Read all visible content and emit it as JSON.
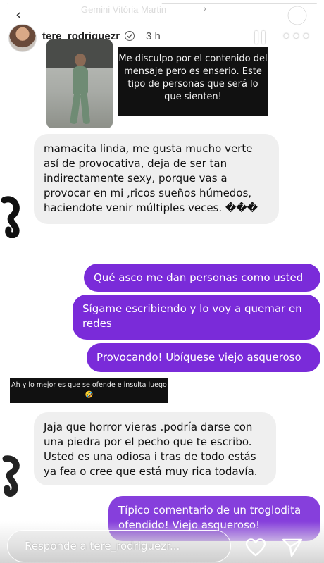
{
  "story": {
    "progress": 0.5,
    "ghost_title": "Gemini Vitória Martin",
    "username": "tere_rodriguezr",
    "time": "3 h",
    "icons": {
      "back": "chevron-left-icon",
      "verified": "verified-badge-icon",
      "pause": "pause-icon",
      "more": "more-icon",
      "sticker": "sticker-icon",
      "heart": "heart-icon",
      "share": "paper-plane-icon"
    }
  },
  "captions": {
    "top": "Me disculpo por el contenido del mensaje pero es enserio. Este tipo de personas que será lo que sienten!",
    "middle": "Ah y lo mejor es que se ofende e insulta luego 🤣"
  },
  "messages": [
    {
      "direction": "incoming",
      "text": "mamacita linda, me gusta mucho verte así de provocativa, deja de ser tan indirectamente sexy, porque vas a provocar en mi ,ricos sueños húmedos, haciendote  venir múltiples veces. ���"
    },
    {
      "direction": "outgoing",
      "text": "Qué asco me dan personas como usted"
    },
    {
      "direction": "outgoing",
      "text": "Sígame escribiendo y lo voy a quemar en redes"
    },
    {
      "direction": "outgoing",
      "text": "Provocando! Ubíquese viejo asqueroso"
    },
    {
      "direction": "incoming",
      "text": "Jaja que horror vieras .podría darse con una piedra por el pecho que te escribo. Usted es una odiosa i tras de todo estás ya fea o cree que está muy rica todavía."
    },
    {
      "direction": "outgoing",
      "text": "Típico comentario de un troglodita ofendido! Viejo asqueroso!"
    }
  ],
  "reply": {
    "placeholder": "Responde a tere_rodriguezr..."
  },
  "colors": {
    "outgoing_bubble": "#7a2bd9",
    "incoming_bubble": "#efefef",
    "caption_bg": "#111111"
  }
}
